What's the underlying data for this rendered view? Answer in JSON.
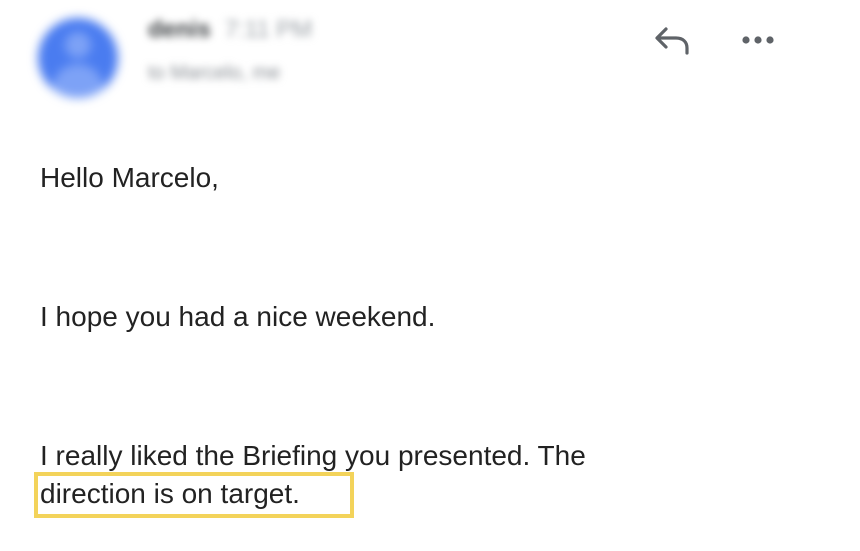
{
  "header": {
    "sender_name": "denis",
    "sender_time": "7:11 PM",
    "recipient": "to Marcelo, me",
    "reply_icon": "reply-icon",
    "more_icon": "more-horizontal-icon",
    "avatar_icon": "person-icon",
    "avatar_color": "#4a7cf0"
  },
  "message": {
    "greeting": "Hello Marcelo,",
    "paragraph_1": "I hope you had a nice weekend.",
    "paragraph_2_line_1": "I really liked the Briefing you presented. The",
    "paragraph_2_line_2": "direction is on target."
  },
  "highlight": {
    "color": "#f3d35a"
  }
}
